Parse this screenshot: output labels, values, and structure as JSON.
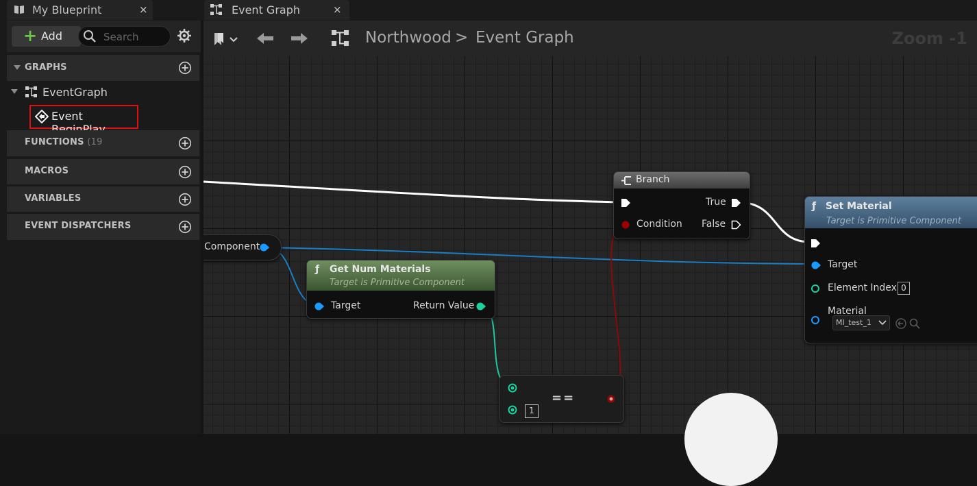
{
  "left_panel": {
    "tab_title": "My Blueprint",
    "tab_close": "×",
    "add_label": "Add",
    "search_placeholder": "Search",
    "graphs_title": "GRAPHS",
    "event_graph_label": "EventGraph",
    "begin_play_label": "Event BeginPlay",
    "functions_title": "FUNCTIONS",
    "functions_count": "(19",
    "macros_title": "MACROS",
    "variables_title": "VARIABLES",
    "dispatchers_title": "EVENT DISPATCHERS"
  },
  "graph": {
    "tab_title": "Event Graph",
    "tab_close": "×",
    "breadcrumb_root": "Northwood",
    "breadcrumb_sep": ">",
    "breadcrumb_current": "Event Graph",
    "zoom_label": "Zoom -1"
  },
  "nodes": {
    "component_label": "Component",
    "branch": {
      "title": "Branch",
      "true_label": "True",
      "false_label": "False",
      "condition_label": "Condition"
    },
    "set_material": {
      "title": "Set Material",
      "subtitle": "Target is Primitive Component",
      "target_label": "Target",
      "element_index_label": "Element Index",
      "element_index_value": "0",
      "material_label": "Material",
      "material_value": "MI_test_1"
    },
    "get_num_materials": {
      "title": "Get Num Materials",
      "subtitle": "Target is Primitive Component",
      "target_label": "Target",
      "return_label": "Return Value"
    },
    "equal": {
      "operator": "==",
      "b_value": "1"
    }
  },
  "colors": {
    "exec_wire": "#ffffff",
    "object_pin": "#1a9bff",
    "int_pin": "#1ecfa0",
    "bool_pin": "#a00000",
    "highlight": "#e01010"
  }
}
